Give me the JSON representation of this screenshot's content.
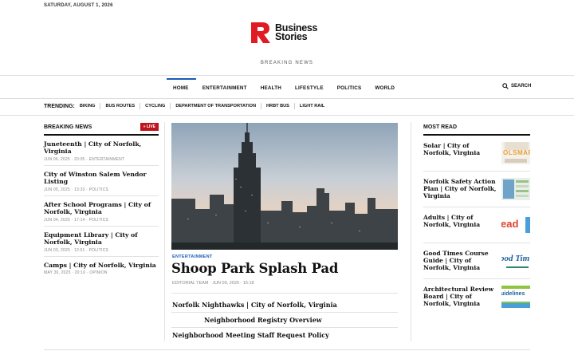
{
  "header": {
    "date": "SATURDAY, AUGUST 1, 2026",
    "brand_line1": "Business",
    "brand_line2": "Stories",
    "tagline": "BREAKING NEWS",
    "brand_color": "#e01b24"
  },
  "nav": {
    "items": [
      "HOME",
      "ENTERTAINMENT",
      "HEALTH",
      "LIFESTYLE",
      "POLITICS",
      "WORLD"
    ],
    "active": "HOME",
    "search_label": "SEARCH",
    "accent": "#1a5bb8"
  },
  "trending": {
    "label": "TRENDING:",
    "items": [
      "BIKING",
      "BUS ROUTES",
      "CYCLING",
      "DEPARTMENT OF TRANSPORTATION",
      "HRBT BUS",
      "LIGHT RAIL"
    ]
  },
  "breaking": {
    "title": "BREAKING NEWS",
    "live_label": "» LIVE",
    "items": [
      {
        "title": "Juneteenth | City of Norfolk, Virginia",
        "meta": "JUN 06, 2025 · 20:05 · ENTERTAINMENT"
      },
      {
        "title": "City of Winston Salem Vendor Listing",
        "meta": "JUN 05, 2025 · 13:33 · POLITICS"
      },
      {
        "title": "After School Programs | City of Norfolk, Virginia",
        "meta": "JUN 04, 2025 · 17:14 · POLITICS"
      },
      {
        "title": "Equipment Library | City of Norfolk, Virginia",
        "meta": "JUN 03, 2025 · 12:51 · POLITICS"
      },
      {
        "title": "Camps | City of Norfolk, Virginia",
        "meta": "MAY 30, 2025 · 20:16 · OPINION"
      }
    ]
  },
  "feature": {
    "category": "ENTERTAINMENT",
    "headline": "Shoop Park Splash Pad",
    "byline": "EDITORIAL TEAM · JUN 09, 2025 · 16:18",
    "related": [
      "Norfolk Nighthawks | City of Norfolk, Virginia",
      "Neighborhood Registry Overview",
      "Neighborhood Meeting Staff Request Policy"
    ]
  },
  "most_read": {
    "title": "MOST READ",
    "items": [
      {
        "title": "Solar | City of Norfolk, Virginia",
        "thumb_text": "OLSMAR",
        "thumb_icon": "solar-thumbnail"
      },
      {
        "title": "Norfolk Safety Action Plan | City of Norfolk, Virginia",
        "thumb_text": "",
        "thumb_icon": "safety-plan-thumbnail"
      },
      {
        "title": "Adults | City of Norfolk, Virginia",
        "thumb_text": "ead",
        "thumb_icon": "adults-thumbnail"
      },
      {
        "title": "Good Times Course Guide | City of Norfolk, Virginia",
        "thumb_text": "ood Tim",
        "thumb_icon": "course-guide-thumbnail"
      },
      {
        "title": "Architectural Review Board | City of Norfolk, Virginia",
        "thumb_text": "uidelines",
        "thumb_icon": "guidelines-thumbnail"
      }
    ]
  }
}
